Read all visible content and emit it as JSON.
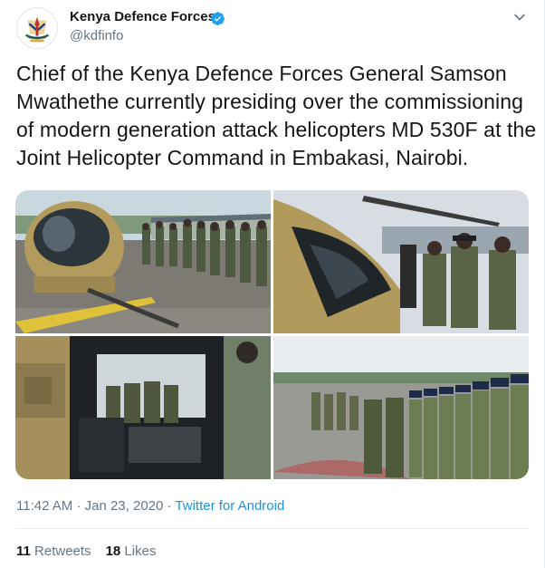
{
  "user": {
    "display_name": "Kenya Defence Forces",
    "handle": "@kdfinfo",
    "verified": true,
    "verified_color": "#1da1f2"
  },
  "tweet": {
    "text": "Chief of the Kenya Defence Forces General Samson Mwathethe currently presiding over the commissioning of modern generation attack helicopters MD 530F at the Joint Helicopter Command in Embakasi, Nairobi."
  },
  "media": {
    "photos": [
      {
        "name": "photo-helicopter-front-officers"
      },
      {
        "name": "photo-helicopter-inspection"
      },
      {
        "name": "photo-cockpit-interior"
      },
      {
        "name": "photo-officers-lineup"
      }
    ]
  },
  "meta": {
    "time": "11:42 AM",
    "separator_1": " · ",
    "date": "Jan 23, 2020",
    "separator_2": " · ",
    "source": "Twitter for Android"
  },
  "stats": {
    "retweets_count": "11",
    "retweets_label": "Retweets",
    "likes_count": "18",
    "likes_label": "Likes"
  },
  "icons": {
    "verified": "verified-badge-icon",
    "caret": "chevron-down-icon"
  },
  "colors": {
    "text": "#14171a",
    "secondary": "#657786",
    "link": "#1b95e0"
  }
}
